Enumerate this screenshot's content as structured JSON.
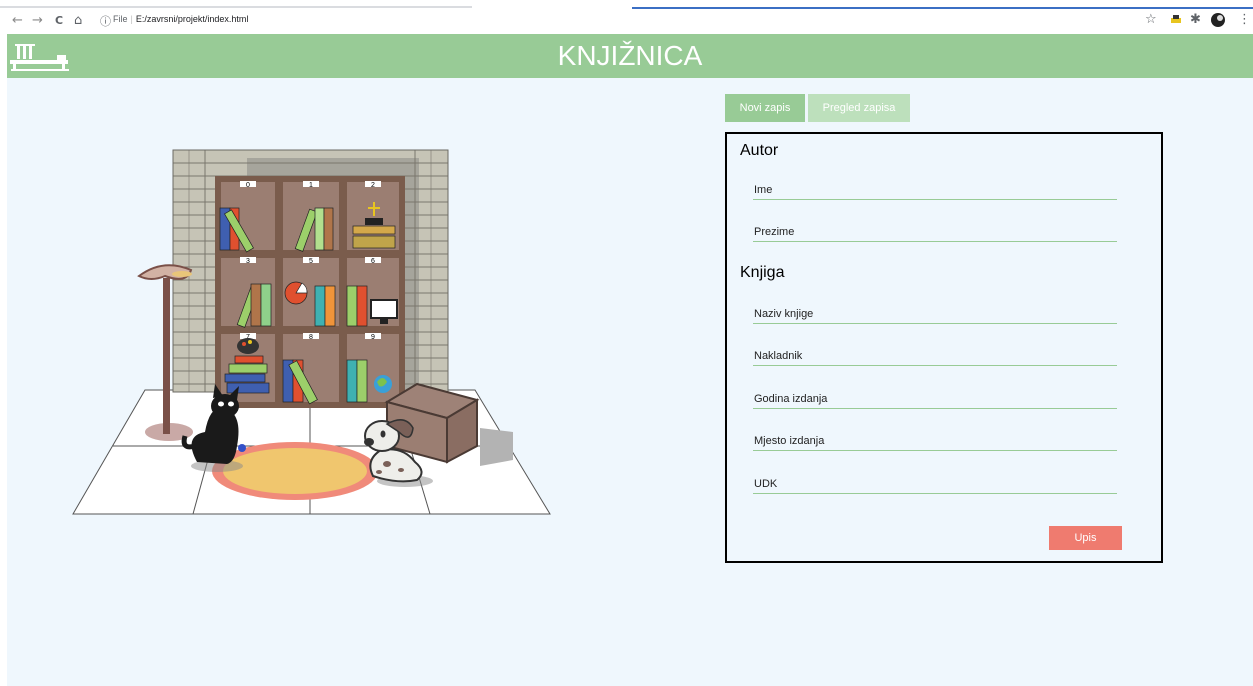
{
  "browser": {
    "back_icon": "←",
    "forward_icon": "→",
    "reload_icon": "C",
    "home_icon": "⌂",
    "info_icon": "ⓘ",
    "url_label": "File",
    "url": "E:/zavrsni/projekt/index.html",
    "star_icon": "☆",
    "puzzle_icon": "✱"
  },
  "header": {
    "title": "KNJIŽNICA",
    "color": "#98cb96"
  },
  "tabs": {
    "new_entry": "Novi zapis",
    "view_entries": "Pregled zapisa"
  },
  "shelf_labels": [
    "0",
    "1",
    "2",
    "3",
    "5",
    "6",
    "7",
    "8",
    "9"
  ],
  "form": {
    "author_heading": "Autor",
    "first_name_placeholder": "Ime",
    "last_name_placeholder": "Prezime",
    "book_heading": "Knjiga",
    "title_placeholder": "Naziv knjige",
    "publisher_placeholder": "Nakladnik",
    "year_placeholder": "Godina izdanja",
    "place_placeholder": "Mjesto izdanja",
    "udk_placeholder": "UDK",
    "submit_label": "Upis",
    "submit_color": "#ef7b6f"
  },
  "colors": {
    "page_background": "#eff7fd",
    "accent_green": "#98cb96",
    "tab_inactive": "#bde0bc"
  }
}
